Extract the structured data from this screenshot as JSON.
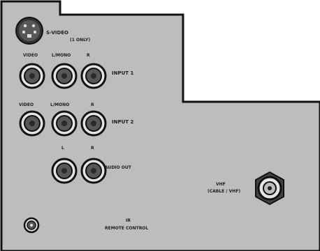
{
  "panel": {
    "colors": {
      "panel": "#bdbdbd",
      "outline": "#111111",
      "jack_outer": "#e4e4e4",
      "jack_inner": "#575757",
      "text": "#202020"
    },
    "labels": {
      "s_video": "S-VIDEO",
      "s_video_sub": "(1 ONLY)",
      "input1_video": "VIDEO",
      "input1_laudio": "L/MONO",
      "input1_r": "R",
      "input1": "INPUT 1",
      "input2_video": "VIDEO",
      "input2_laudio": "L/MONO",
      "input2_r": "R",
      "input2": "INPUT 2",
      "audio_out_l": "L",
      "audio_out_r": "R",
      "audio_out": "AUDIO OUT",
      "vhf_line1": "VHF",
      "vhf_line2": "(CABLE / VHF)",
      "ir_line1": "IR",
      "ir_line2": "REMOTE CONTROL"
    },
    "icons": {
      "s_video_port": "s-video-port-icon",
      "rca_jack": "rca-jack-icon",
      "coax": "coax-connector-icon",
      "ir_jack": "ir-jack-icon"
    }
  }
}
